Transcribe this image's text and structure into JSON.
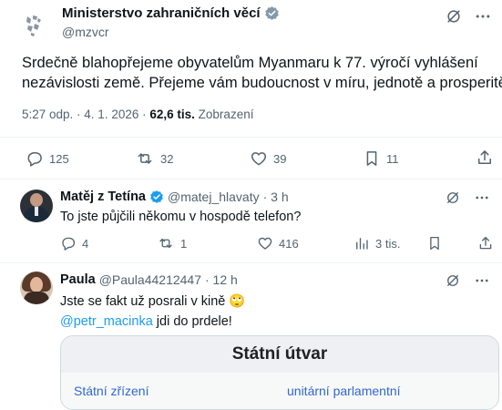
{
  "main_post": {
    "author_name": "Ministerstvo zahraničních věcí",
    "handle": "@mzvcr",
    "text_line1": "Srdečně blahopřejeme obyvatelům Myanmaru k 77. výročí vyhlášení",
    "text_line2": "nezávislosti země. Přejeme vám budoucnost v míru, jednotě a prosperitě.",
    "timestamp": "5:27 odp. · 4. 1. 2026 ·",
    "views_count": "62,6 tis.",
    "views_label": "Zobrazení",
    "replies": "125",
    "reposts": "32",
    "likes": "39",
    "bookmarks": "11"
  },
  "reply1": {
    "author_name": "Matěj z Tetína",
    "handle": "@matej_hlavaty",
    "time": "· 3 h",
    "text": "To jste půjčili někomu v hospodě telefon?",
    "replies": "4",
    "reposts": "1",
    "likes": "416",
    "views": "3 tis."
  },
  "reply2": {
    "author_name": "Paula",
    "handle": "@Paula44212447",
    "time": "· 12 h",
    "text_line1": "Jste se fakt už posrali v kině",
    "emoji": "🙄",
    "mention": "@petr_macinka",
    "text_line2": "jdi do prdele!",
    "embed": {
      "title": "Státní útvar",
      "partial_left": "Státní zřízení",
      "partial_right": "unitární parlamentní"
    }
  }
}
